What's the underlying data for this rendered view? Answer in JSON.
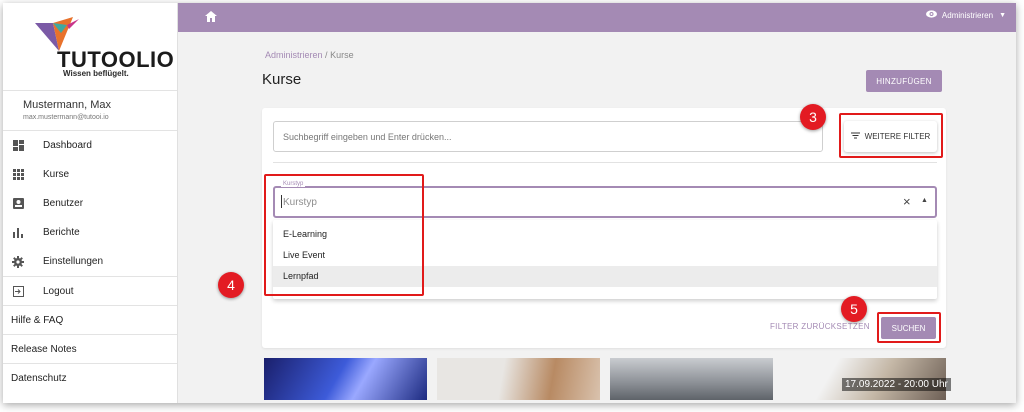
{
  "brand": {
    "name": "TUTOOLIO",
    "tagline": "Wissen beflügelt."
  },
  "user": {
    "name": "Mustermann, Max",
    "email": "max.mustermann@tutooi.io"
  },
  "sidebar": {
    "items": [
      {
        "label": "Dashboard",
        "icon": "dashboard-icon"
      },
      {
        "label": "Kurse",
        "icon": "grid-icon"
      },
      {
        "label": "Benutzer",
        "icon": "user-card-icon"
      },
      {
        "label": "Berichte",
        "icon": "bar-chart-icon"
      },
      {
        "label": "Einstellungen",
        "icon": "gear-icon"
      }
    ],
    "logout": "Logout",
    "links": [
      "Hilfe & FAQ",
      "Release Notes",
      "Datenschutz"
    ]
  },
  "topbar": {
    "role": "Administrieren",
    "accent": "#a48ab4"
  },
  "breadcrumb": {
    "parent": "Administrieren",
    "separator": "/",
    "current": "Kurse"
  },
  "page": {
    "title": "Kurse",
    "add_label": "HINZUFÜGEN"
  },
  "search": {
    "placeholder": "Suchbegriff eingeben und Enter drücken..."
  },
  "filter": {
    "more_label": "WEITERE FILTER"
  },
  "kurstyp": {
    "legend": "Kurstyp",
    "placeholder": "Kurstyp",
    "options": [
      "E-Learning",
      "Live Event",
      "Lernpfad"
    ]
  },
  "actions": {
    "reset_label": "FILTER ZURÜCKSETZEN",
    "search_label": "SUCHEN"
  },
  "annotations": {
    "step3": "3",
    "step4": "4",
    "step5": "5"
  },
  "thumbnails": {
    "date_caption": "17.09.2022 - 20:00 Uhr"
  }
}
